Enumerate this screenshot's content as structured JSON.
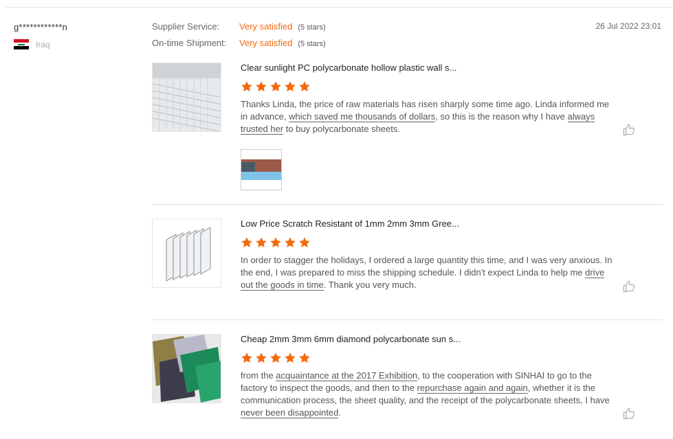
{
  "reviewer": {
    "name": "g************n",
    "country": "Iraq"
  },
  "ratings": [
    {
      "label": "Supplier Service:",
      "value": "Very satisfied",
      "stars_text": "(5 stars)"
    },
    {
      "label": "On-time Shipment:",
      "value": "Very satisfied",
      "stars_text": "(5 stars)"
    }
  ],
  "date": "26 Jul 2022 23:01",
  "items": [
    {
      "title": "Clear sunlight PC polycarbonate hollow plastic wall s...",
      "stars": 5,
      "text_parts": [
        "Thanks Linda, the price of raw materials has risen sharply some time ago. Linda informed me in advance, ",
        "which saved me thousands of dollars",
        ", so this is the reason why I have ",
        "always trusted her",
        " to buy polycarbonate sheets."
      ]
    },
    {
      "title": "Low Price Scratch Resistant of 1mm 2mm 3mm Gree...",
      "stars": 5,
      "text_parts": [
        "In order to stagger the holidays, I ordered a large quantity this time, and I was very anxious. In the end, I was prepared to miss the shipping schedule. I didn't expect Linda to help me ",
        "drive out the goods in time",
        ". Thank you very much."
      ]
    },
    {
      "title": "Cheap 2mm 3mm 6mm diamond polycarbonate sun s...",
      "stars": 5,
      "text_parts": [
        "from the ",
        "acquaintance at the 2017 Exhibition",
        ", to the cooperation with SINHAI to go to the factory to inspect the goods, and then to the ",
        "repurchase again and again",
        ", whether it is the communication process, the sheet quality, and the receipt of the polycarbonate sheets, I have ",
        "never been disappointed",
        "."
      ]
    }
  ],
  "colors": {
    "accent": "#f26a10",
    "text": "#555555",
    "divider": "#e3e3e3"
  },
  "icons": {
    "star": "star-icon",
    "like": "thumbs-up-icon",
    "flag": "iraq-flag-icon"
  }
}
